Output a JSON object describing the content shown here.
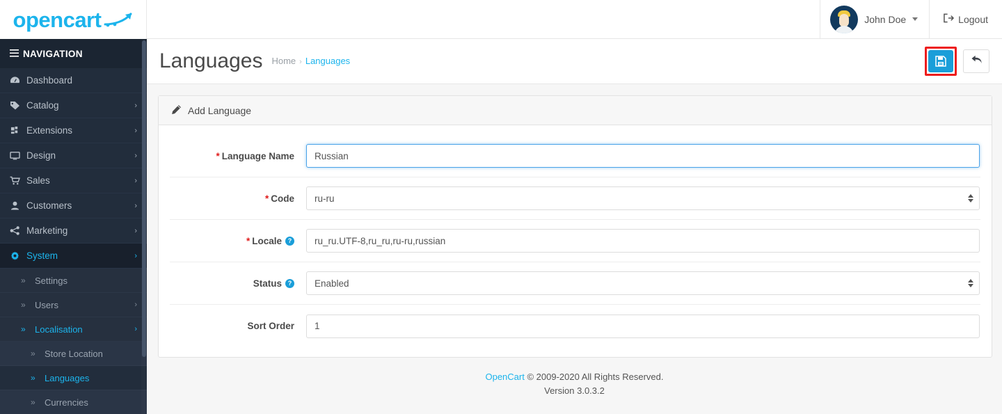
{
  "brand": {
    "name": "opencart",
    "accent": "#1cb4ec"
  },
  "header": {
    "user_name": "John Doe",
    "logout_label": "Logout"
  },
  "sidebar": {
    "title": "NAVIGATION",
    "items": [
      {
        "label": "Dashboard",
        "icon": "dashboard-icon",
        "chevron": "",
        "active": false
      },
      {
        "label": "Catalog",
        "icon": "tag-icon",
        "chevron": "›",
        "active": false
      },
      {
        "label": "Extensions",
        "icon": "puzzle-icon",
        "chevron": "›",
        "active": false
      },
      {
        "label": "Design",
        "icon": "monitor-icon",
        "chevron": "›",
        "active": false
      },
      {
        "label": "Sales",
        "icon": "cart-icon",
        "chevron": "›",
        "active": false
      },
      {
        "label": "Customers",
        "icon": "user-icon",
        "chevron": "›",
        "active": false
      },
      {
        "label": "Marketing",
        "icon": "share-icon",
        "chevron": "›",
        "active": false
      },
      {
        "label": "System",
        "icon": "gear-icon",
        "chevron": "›",
        "active": true
      }
    ],
    "sub_items": [
      {
        "label": "Settings",
        "chevron": ""
      },
      {
        "label": "Users",
        "chevron": "›"
      },
      {
        "label": "Localisation",
        "chevron": "›",
        "active": true
      }
    ],
    "sub_sub_items": [
      {
        "label": "Store Location",
        "active": false
      },
      {
        "label": "Languages",
        "active": true
      },
      {
        "label": "Currencies",
        "active": false
      }
    ]
  },
  "page": {
    "title": "Languages",
    "breadcrumb": {
      "home": "Home",
      "separator": "›",
      "current": "Languages"
    },
    "save_icon": "floppy-disk-icon",
    "back_icon": "back-arrow-icon"
  },
  "panel": {
    "heading": "Add Language",
    "heading_icon": "pencil-icon",
    "fields": [
      {
        "label": "Language Name",
        "required": true,
        "help": false,
        "type": "text",
        "value": "Russian",
        "placeholder": "Language Name",
        "focused": true
      },
      {
        "label": "Code",
        "required": true,
        "help": false,
        "type": "select",
        "value": "ru-ru",
        "placeholder": "",
        "focused": false
      },
      {
        "label": "Locale",
        "required": true,
        "help": true,
        "type": "text",
        "value": "ru_ru.UTF-8,ru_ru,ru-ru,russian",
        "placeholder": "Locale",
        "focused": false
      },
      {
        "label": "Status",
        "required": false,
        "help": true,
        "type": "select",
        "value": "Enabled",
        "placeholder": "",
        "focused": false
      },
      {
        "label": "Sort Order",
        "required": false,
        "help": false,
        "type": "text",
        "value": "1",
        "placeholder": "Sort Order",
        "focused": false
      }
    ]
  },
  "footer": {
    "link": "OpenCart",
    "copyright": "© 2009-2020 All Rights Reserved.",
    "version": "Version 3.0.3.2"
  }
}
